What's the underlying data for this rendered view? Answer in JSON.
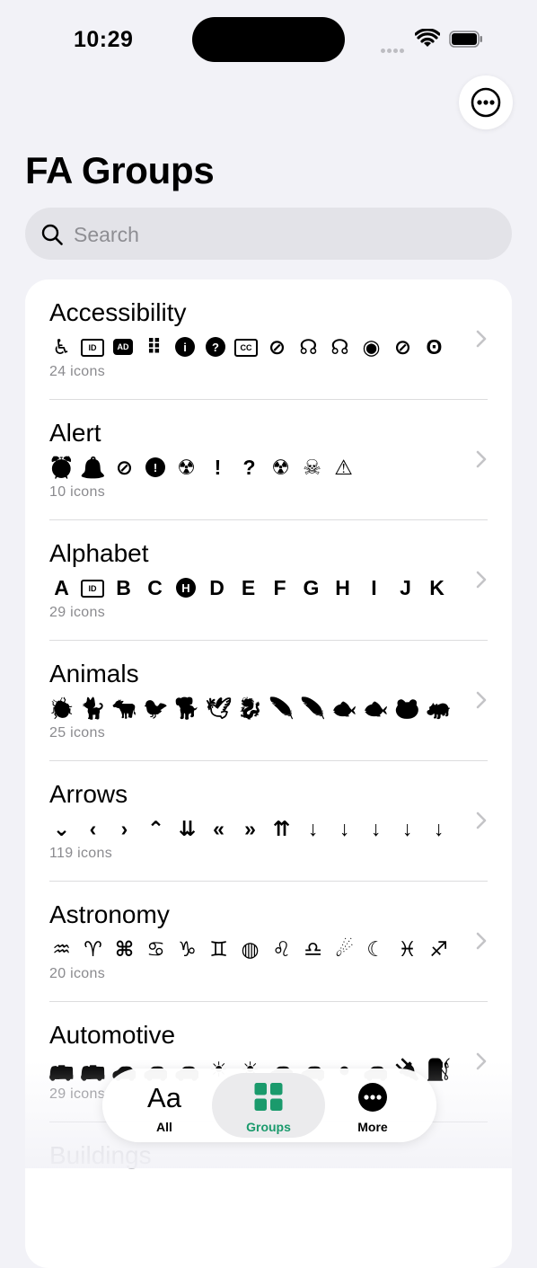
{
  "status": {
    "time": "10:29"
  },
  "header": {
    "title": "FA Groups"
  },
  "search": {
    "placeholder": "Search"
  },
  "groups": [
    {
      "name": "Accessibility",
      "count": "24 icons",
      "icons": [
        {
          "c": "♿",
          "k": "plain"
        },
        {
          "c": "ID",
          "k": "box"
        },
        {
          "c": "AD",
          "k": "fill"
        },
        {
          "c": "⠿",
          "k": "plain"
        },
        {
          "c": "i",
          "k": "solid"
        },
        {
          "c": "?",
          "k": "solid"
        },
        {
          "c": "CC",
          "k": "box"
        },
        {
          "c": "⊘",
          "k": "plain"
        },
        {
          "c": "☊",
          "k": "plain"
        },
        {
          "c": "☊",
          "k": "plain"
        },
        {
          "c": "◉",
          "k": "plain"
        },
        {
          "c": "⊘",
          "k": "plain"
        },
        {
          "c": "ʘ",
          "k": "plain"
        }
      ]
    },
    {
      "name": "Alert",
      "count": "10 icons",
      "icons": [
        {
          "c": "⏰",
          "k": "plain"
        },
        {
          "c": "🔔",
          "k": "plain"
        },
        {
          "c": "⊘",
          "k": "plain"
        },
        {
          "c": "!",
          "k": "solid"
        },
        {
          "c": "☢",
          "k": "plain"
        },
        {
          "c": "!",
          "k": "plain"
        },
        {
          "c": "?",
          "k": "plain"
        },
        {
          "c": "☢",
          "k": "plain"
        },
        {
          "c": "☠",
          "k": "plain"
        },
        {
          "c": "⚠",
          "k": "plain"
        }
      ]
    },
    {
      "name": "Alphabet",
      "count": "29 icons",
      "icons": [
        {
          "c": "A",
          "k": "plain"
        },
        {
          "c": "ID",
          "k": "box"
        },
        {
          "c": "B",
          "k": "plain"
        },
        {
          "c": "C",
          "k": "plain"
        },
        {
          "c": "H",
          "k": "solid"
        },
        {
          "c": "D",
          "k": "plain"
        },
        {
          "c": "E",
          "k": "plain"
        },
        {
          "c": "F",
          "k": "plain"
        },
        {
          "c": "G",
          "k": "plain"
        },
        {
          "c": "H",
          "k": "plain"
        },
        {
          "c": "I",
          "k": "plain"
        },
        {
          "c": "J",
          "k": "plain"
        },
        {
          "c": "K",
          "k": "plain"
        }
      ]
    },
    {
      "name": "Animals",
      "count": "25 icons",
      "icons": [
        {
          "c": "🐞",
          "k": "plain"
        },
        {
          "c": "🐈",
          "k": "plain"
        },
        {
          "c": "🐄",
          "k": "plain"
        },
        {
          "c": "🐦",
          "k": "plain"
        },
        {
          "c": "🐕",
          "k": "plain"
        },
        {
          "c": "🕊",
          "k": "plain"
        },
        {
          "c": "🐉",
          "k": "plain"
        },
        {
          "c": "🪶",
          "k": "plain"
        },
        {
          "c": "🪶",
          "k": "plain"
        },
        {
          "c": "🐟",
          "k": "plain"
        },
        {
          "c": "🐟",
          "k": "plain"
        },
        {
          "c": "🐸",
          "k": "plain"
        },
        {
          "c": "🦛",
          "k": "plain"
        }
      ]
    },
    {
      "name": "Arrows",
      "count": "119 icons",
      "icons": [
        {
          "c": "⌄",
          "k": "plain"
        },
        {
          "c": "‹",
          "k": "plain"
        },
        {
          "c": "›",
          "k": "plain"
        },
        {
          "c": "⌃",
          "k": "plain"
        },
        {
          "c": "⇊",
          "k": "plain"
        },
        {
          "c": "«",
          "k": "plain"
        },
        {
          "c": "»",
          "k": "plain"
        },
        {
          "c": "⇈",
          "k": "plain"
        },
        {
          "c": "↓",
          "k": "plain"
        },
        {
          "c": "↓",
          "k": "plain"
        },
        {
          "c": "↓",
          "k": "plain"
        },
        {
          "c": "↓",
          "k": "plain"
        },
        {
          "c": "↓",
          "k": "plain"
        }
      ]
    },
    {
      "name": "Astronomy",
      "count": "20 icons",
      "icons": [
        {
          "c": "♒",
          "k": "plain"
        },
        {
          "c": "♈",
          "k": "plain"
        },
        {
          "c": "⌘",
          "k": "plain"
        },
        {
          "c": "♋",
          "k": "plain"
        },
        {
          "c": "♑",
          "k": "plain"
        },
        {
          "c": "♊",
          "k": "plain"
        },
        {
          "c": "◍",
          "k": "plain"
        },
        {
          "c": "♌",
          "k": "plain"
        },
        {
          "c": "♎",
          "k": "plain"
        },
        {
          "c": "☄",
          "k": "plain"
        },
        {
          "c": "☾",
          "k": "plain"
        },
        {
          "c": "♓",
          "k": "plain"
        },
        {
          "c": "♐",
          "k": "plain"
        }
      ]
    },
    {
      "name": "Automotive",
      "count": "29 icons",
      "icons": [
        {
          "c": "🚌",
          "k": "plain"
        },
        {
          "c": "🚌",
          "k": "plain"
        },
        {
          "c": "🚗",
          "k": "plain"
        },
        {
          "c": "🚗",
          "k": "plain"
        },
        {
          "c": "🚗",
          "k": "plain"
        },
        {
          "c": "☀",
          "k": "plain"
        },
        {
          "c": "☀",
          "k": "plain"
        },
        {
          "c": "🚗",
          "k": "plain"
        },
        {
          "c": "🚗",
          "k": "plain"
        },
        {
          "c": "●",
          "k": "plain"
        },
        {
          "c": "🚗",
          "k": "plain"
        },
        {
          "c": "🔌",
          "k": "plain"
        },
        {
          "c": "⛽",
          "k": "plain"
        }
      ]
    },
    {
      "name": "Buildings",
      "count": "",
      "icons": []
    }
  ],
  "tabs": [
    {
      "label": "All",
      "glyph": "Aa"
    },
    {
      "label": "Groups"
    },
    {
      "label": "More"
    }
  ],
  "colors": {
    "accent": "#1a9a6c",
    "background": "#f2f2f7",
    "secondary_text": "#8a8a8e"
  }
}
